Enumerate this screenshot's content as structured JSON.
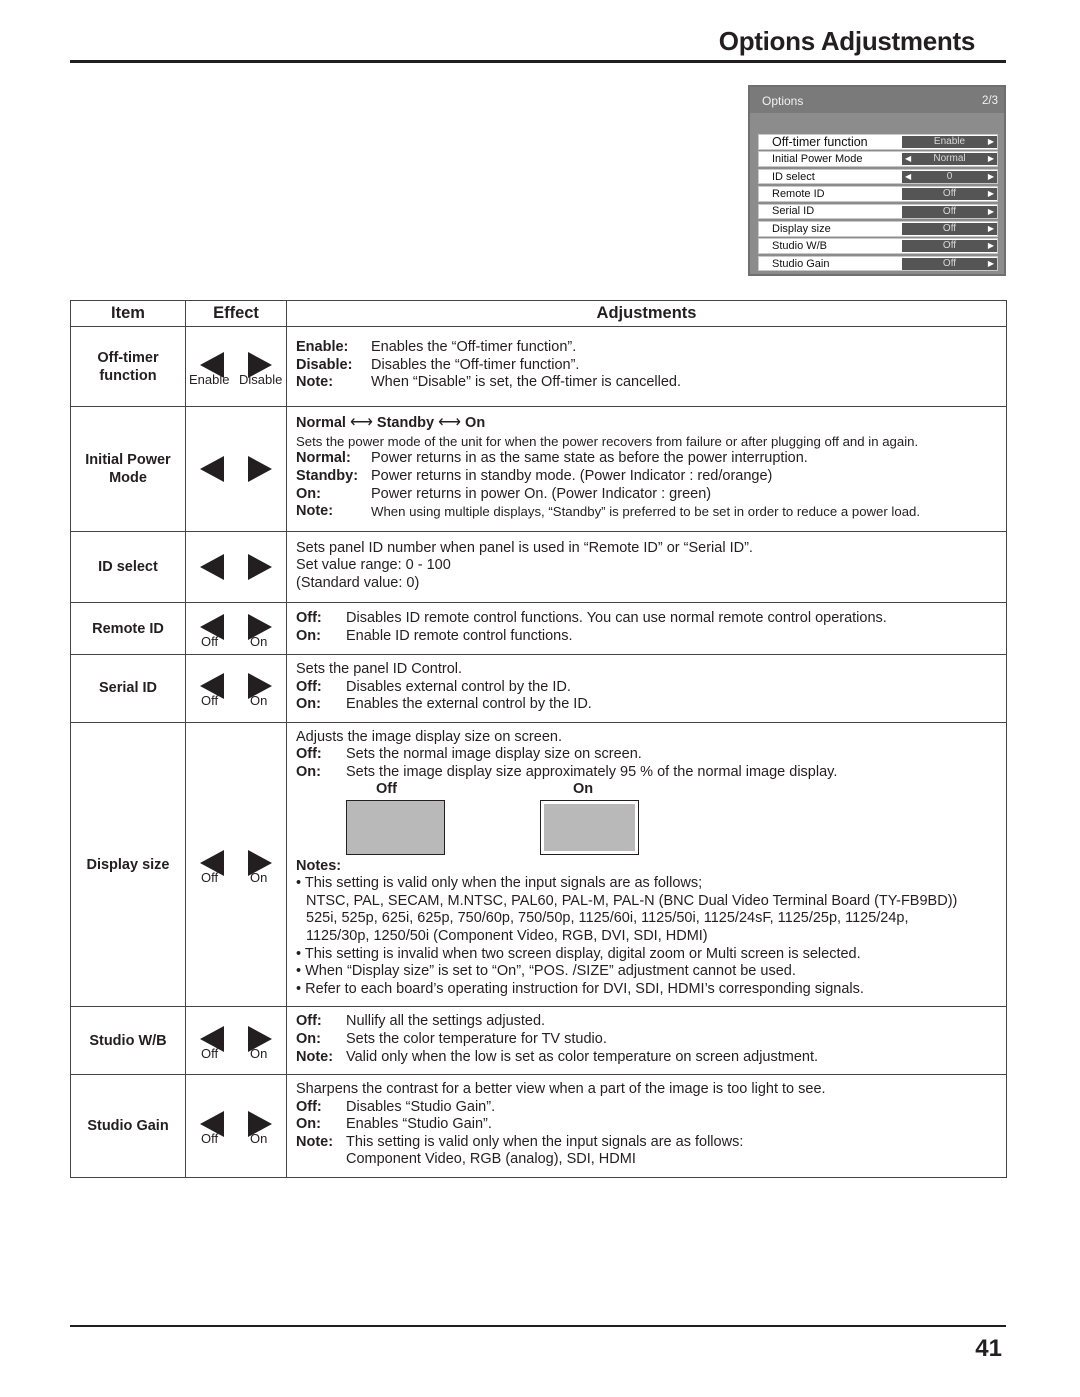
{
  "page": {
    "title": "Options Adjustments",
    "page_number": "41"
  },
  "osd": {
    "title": "Options",
    "page": "2/3",
    "rows": [
      {
        "label": "Off-timer function",
        "value": "Enable",
        "left_arrow": false,
        "right_arrow": true
      },
      {
        "label": "Initial Power Mode",
        "value": "Normal",
        "left_arrow": true,
        "right_arrow": true
      },
      {
        "label": "ID select",
        "value": "0",
        "left_arrow": true,
        "right_arrow": true
      },
      {
        "label": "Remote ID",
        "value": "Off",
        "left_arrow": false,
        "right_arrow": true
      },
      {
        "label": "Serial ID",
        "value": "Off",
        "left_arrow": false,
        "right_arrow": true
      },
      {
        "label": "Display size",
        "value": "Off",
        "left_arrow": false,
        "right_arrow": true
      },
      {
        "label": "Studio W/B",
        "value": "Off",
        "left_arrow": false,
        "right_arrow": true
      },
      {
        "label": "Studio Gain",
        "value": "Off",
        "left_arrow": false,
        "right_arrow": true
      }
    ]
  },
  "table": {
    "headers": {
      "item": "Item",
      "effect": "Effect",
      "adjustments": "Adjustments"
    },
    "icons": {
      "left": "left-triangle-icon",
      "right": "right-triangle-icon",
      "both_ways": "double-arrow-icon"
    },
    "rows": {
      "off_timer": {
        "item_line1": "Off-timer",
        "item_line2": "function",
        "effect_left": "Enable",
        "effect_right": "Disable",
        "lines": [
          {
            "key": "Enable:",
            "text": "Enables the “Off-timer function”."
          },
          {
            "key": "Disable:",
            "text": "Disables the “Off-timer function”."
          },
          {
            "key": "Note:",
            "text": "When “Disable” is set, the Off-timer is cancelled."
          }
        ]
      },
      "initial_power": {
        "item_line1": "Initial Power",
        "item_line2": "Mode",
        "sequence": [
          "Normal",
          "Standby",
          "On"
        ],
        "intro": "Sets the power mode of the unit for when the power recovers from failure or after plugging off and in again.",
        "lines": [
          {
            "key": "Normal:",
            "text": "Power returns in as the same state as before the power interruption."
          },
          {
            "key": "Standby:",
            "text": "Power returns in standby mode. (Power Indicator : red/orange)"
          },
          {
            "key": "On:",
            "text": "Power returns in power On. (Power Indicator : green)"
          },
          {
            "key": "Note:",
            "text": "When using multiple displays, “Standby” is preferred to be set in order to reduce a power load."
          }
        ]
      },
      "id_select": {
        "item": "ID select",
        "lines": [
          "Sets panel ID number when panel is used in “Remote ID” or “Serial ID”.",
          "Set value range: 0 - 100",
          "(Standard value: 0)"
        ]
      },
      "remote_id": {
        "item": "Remote ID",
        "effect_left": "Off",
        "effect_right": "On",
        "lines": [
          {
            "key": "Off:",
            "text": "Disables ID remote control functions. You can use normal remote control operations."
          },
          {
            "key": "On:",
            "text": "Enable ID remote control functions."
          }
        ]
      },
      "serial_id": {
        "item": "Serial ID",
        "effect_left": "Off",
        "effect_right": "On",
        "intro": "Sets the panel ID Control.",
        "lines": [
          {
            "key": "Off:",
            "text": "Disables external control by the ID."
          },
          {
            "key": "On:",
            "text": "Enables the external control by the ID."
          }
        ]
      },
      "display_size": {
        "item": "Display size",
        "effect_left": "Off",
        "effect_right": "On",
        "intro": "Adjusts the image display size on screen.",
        "lines": [
          {
            "key": "Off:",
            "text": "Sets the normal image display size on screen."
          },
          {
            "key": "On:",
            "text": "Sets the image display size approximately 95 % of the normal image display."
          }
        ],
        "illustration": {
          "off_caption": "Off",
          "on_caption": "On",
          "on_scale_percent": 95
        },
        "notes_title": "Notes:",
        "notes": [
          "• This setting is valid only when the input signals are as follows;",
          "NTSC, PAL, SECAM, M.NTSC, PAL60, PAL-M, PAL-N (BNC Dual Video Terminal Board (TY-FB9BD))",
          "525i, 525p, 625i, 625p, 750/60p, 750/50p, 1125/60i, 1125/50i, 1125/24sF, 1125/25p, 1125/24p,",
          "1125/30p, 1250/50i (Component Video, RGB, DVI, SDI, HDMI)",
          "• This setting is invalid when two screen display, digital zoom or Multi screen is selected.",
          "• When “Display size” is set to “On”, “POS. /SIZE” adjustment cannot be used.",
          "• Refer to each board’s operating instruction for DVI, SDI, HDMI’s corresponding signals."
        ]
      },
      "studio_wb": {
        "item": "Studio W/B",
        "effect_left": "Off",
        "effect_right": "On",
        "lines": [
          {
            "key": "Off:",
            "text": "Nullify all the settings adjusted."
          },
          {
            "key": "On:",
            "text": "Sets the color temperature for TV studio."
          },
          {
            "key": "Note:",
            "text": "Valid only when the low is set as color temperature on screen adjustment."
          }
        ]
      },
      "studio_gain": {
        "item": "Studio Gain",
        "effect_left": "Off",
        "effect_right": "On",
        "intro": "Sharpens the contrast for a better view when a part of the image is too light to see.",
        "lines": [
          {
            "key": "Off:",
            "text": "Disables “Studio Gain”."
          },
          {
            "key": "On:",
            "text": "Enables “Studio Gain”."
          },
          {
            "key": "Note:",
            "text": "This setting is valid only when the input signals are as follows:"
          }
        ],
        "note_continued": "Component Video, RGB (analog), SDI, HDMI"
      }
    }
  }
}
